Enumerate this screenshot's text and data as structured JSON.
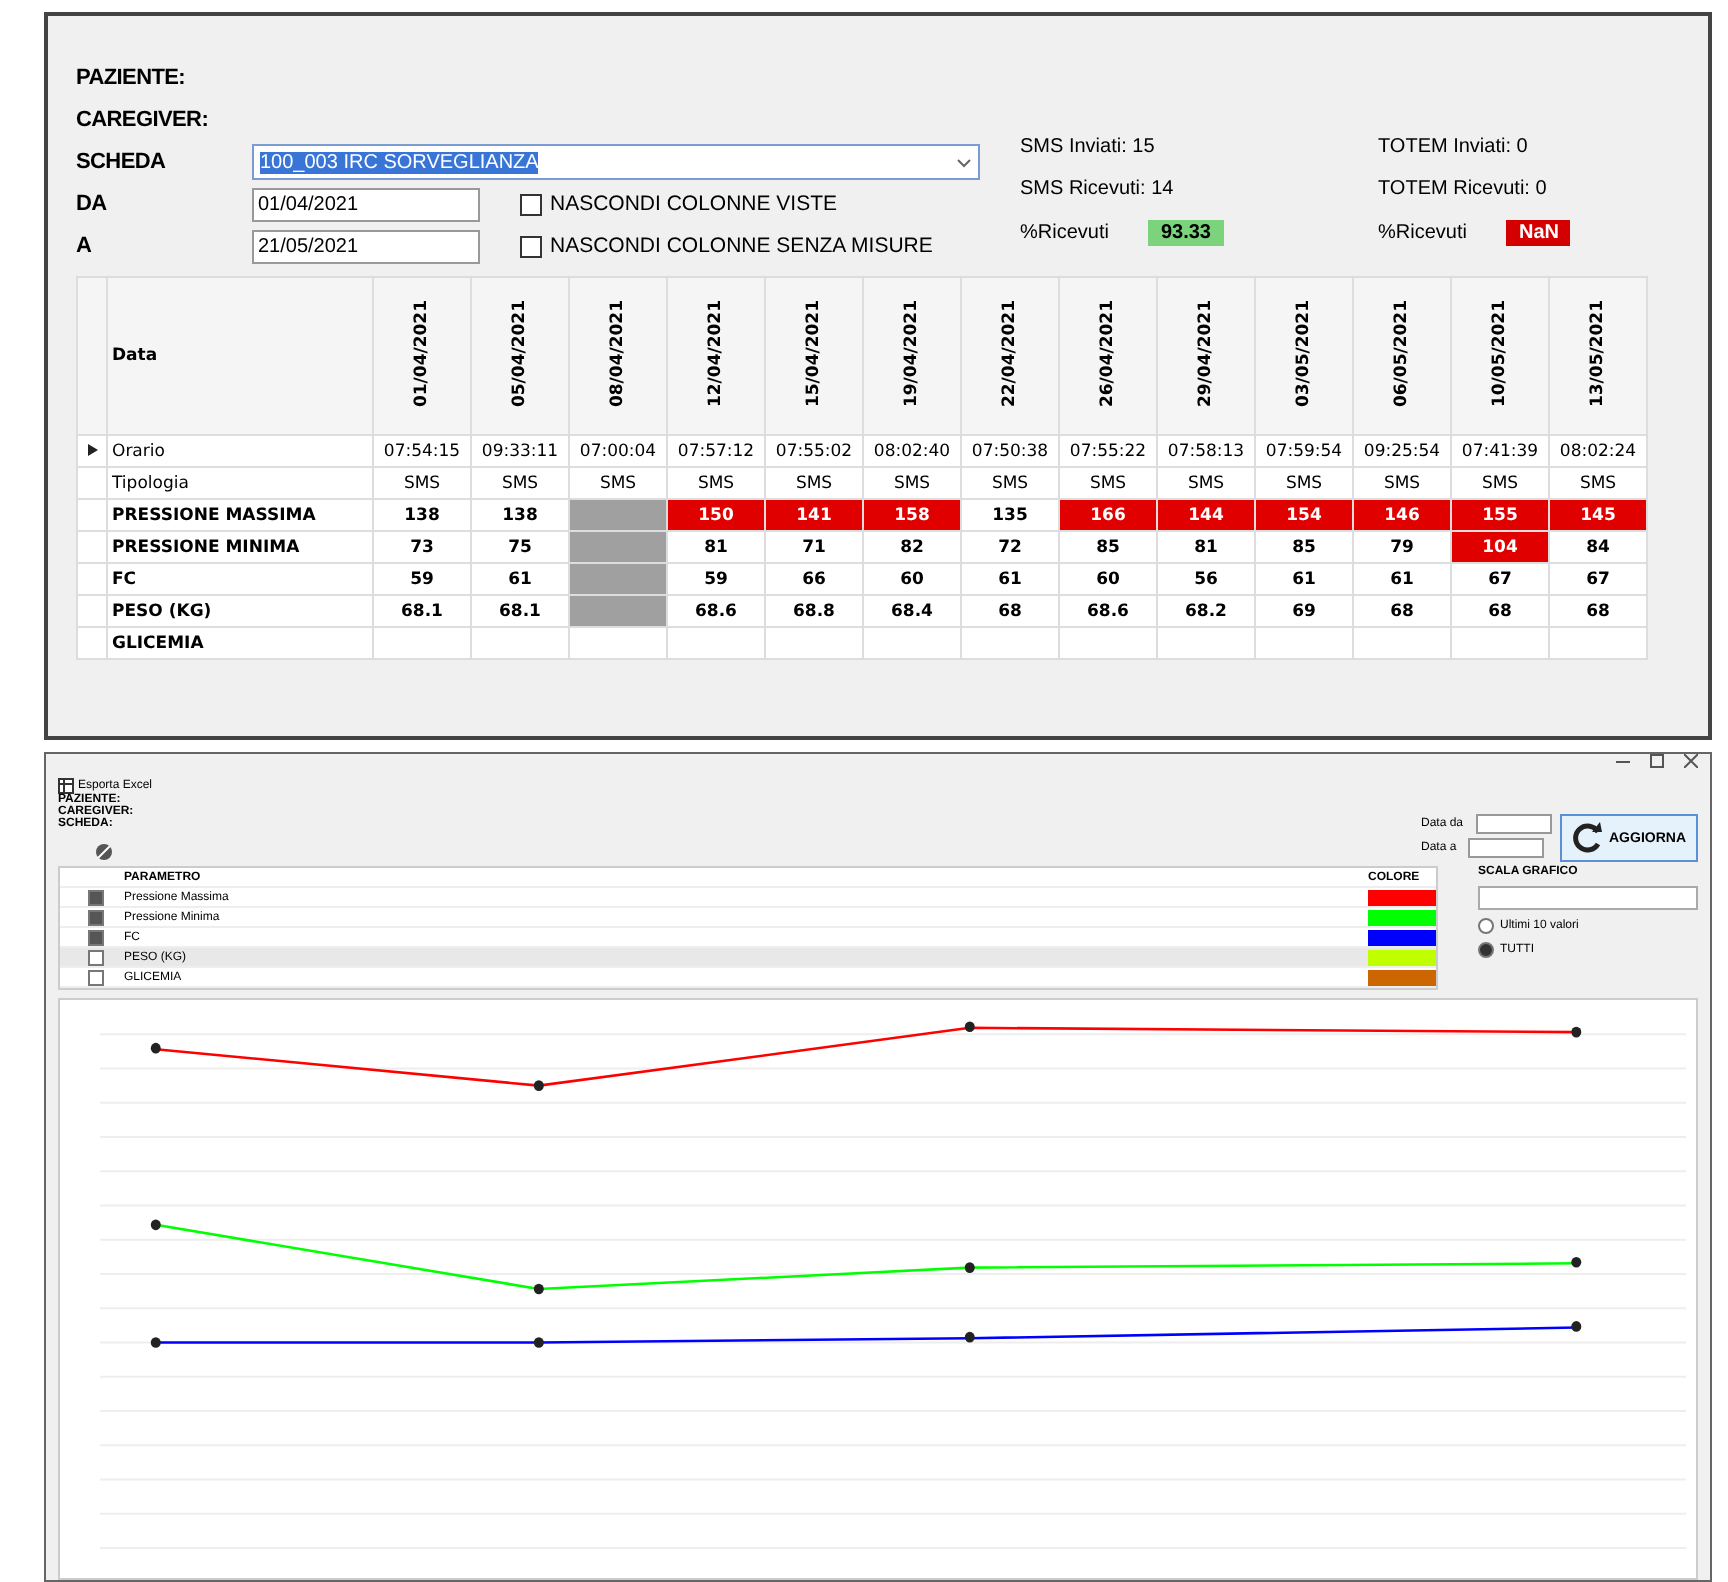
{
  "top": {
    "fields": [
      {
        "label": "PAZIENTE:"
      },
      {
        "label": "CAREGIVER:"
      }
    ],
    "scheda": {
      "label": "SCHEDA",
      "value": "100_003 IRC SORVEGLIANZA"
    },
    "da": {
      "label": "DA",
      "value": "01/04/2021"
    },
    "a": {
      "label": "A",
      "value": "21/05/2021"
    },
    "options": [
      {
        "label": "NASCONDI COLONNE VISTE",
        "checked": false
      },
      {
        "label": "NASCONDI COLONNE SENZA MISURE",
        "checked": false
      }
    ],
    "sms": {
      "sent": "SMS Inviati: 15",
      "received": "SMS Ricevuti: 14",
      "pct_label": "%Ricevuti",
      "pct": "93.33",
      "pct_ok": true
    },
    "totem": {
      "sent": "TOTEM Inviati: 0",
      "received": "TOTEM Ricevuti: 0",
      "pct_label": "%Ricevuti",
      "pct": "NaN",
      "pct_ok": false
    }
  },
  "table": {
    "corner": "Data",
    "columns": [
      "01/04/2021",
      "05/04/2021",
      "08/04/2021",
      "12/04/2021",
      "15/04/2021",
      "19/04/2021",
      "22/04/2021",
      "26/04/2021",
      "29/04/2021",
      "03/05/2021",
      "06/05/2021",
      "10/05/2021",
      "13/05/2021"
    ],
    "rows": [
      {
        "label": "Orario",
        "kind": "info",
        "selected": true,
        "cells": [
          {
            "text": "07:54:15",
            "alert": false,
            "greyed": false
          },
          {
            "text": "09:33:11",
            "alert": false,
            "greyed": false
          },
          {
            "text": "07:00:04",
            "alert": false,
            "greyed": false
          },
          {
            "text": "07:57:12",
            "alert": false,
            "greyed": false
          },
          {
            "text": "07:55:02",
            "alert": false,
            "greyed": false
          },
          {
            "text": "08:02:40",
            "alert": false,
            "greyed": false
          },
          {
            "text": "07:50:38",
            "alert": false,
            "greyed": false
          },
          {
            "text": "07:55:22",
            "alert": false,
            "greyed": false
          },
          {
            "text": "07:58:13",
            "alert": false,
            "greyed": false
          },
          {
            "text": "07:59:54",
            "alert": false,
            "greyed": false
          },
          {
            "text": "09:25:54",
            "alert": false,
            "greyed": false
          },
          {
            "text": "07:41:39",
            "alert": false,
            "greyed": false
          },
          {
            "text": "08:02:24",
            "alert": false,
            "greyed": false
          }
        ]
      },
      {
        "label": "Tipologia",
        "kind": "info",
        "selected": false,
        "cells": [
          {
            "text": "SMS",
            "alert": false,
            "greyed": false
          },
          {
            "text": "SMS",
            "alert": false,
            "greyed": false
          },
          {
            "text": "SMS",
            "alert": false,
            "greyed": false
          },
          {
            "text": "SMS",
            "alert": false,
            "greyed": false
          },
          {
            "text": "SMS",
            "alert": false,
            "greyed": false
          },
          {
            "text": "SMS",
            "alert": false,
            "greyed": false
          },
          {
            "text": "SMS",
            "alert": false,
            "greyed": false
          },
          {
            "text": "SMS",
            "alert": false,
            "greyed": false
          },
          {
            "text": "SMS",
            "alert": false,
            "greyed": false
          },
          {
            "text": "SMS",
            "alert": false,
            "greyed": false
          },
          {
            "text": "SMS",
            "alert": false,
            "greyed": false
          },
          {
            "text": "SMS",
            "alert": false,
            "greyed": false
          },
          {
            "text": "SMS",
            "alert": false,
            "greyed": false
          }
        ]
      },
      {
        "label": "PRESSIONE MASSIMA",
        "kind": "measure",
        "selected": false,
        "cells": [
          {
            "text": "138",
            "alert": false,
            "greyed": false
          },
          {
            "text": "138",
            "alert": false,
            "greyed": false
          },
          {
            "alert": false,
            "greyed": true
          },
          {
            "text": "150",
            "alert": true,
            "greyed": false
          },
          {
            "text": "141",
            "alert": true,
            "greyed": false
          },
          {
            "text": "158",
            "alert": true,
            "greyed": false
          },
          {
            "text": "135",
            "alert": false,
            "greyed": false
          },
          {
            "text": "166",
            "alert": true,
            "greyed": false
          },
          {
            "text": "144",
            "alert": true,
            "greyed": false
          },
          {
            "text": "154",
            "alert": true,
            "greyed": false
          },
          {
            "text": "146",
            "alert": true,
            "greyed": false
          },
          {
            "text": "155",
            "alert": true,
            "greyed": false
          },
          {
            "text": "145",
            "alert": true,
            "greyed": false
          }
        ]
      },
      {
        "label": "PRESSIONE MINIMA",
        "kind": "measure",
        "selected": false,
        "cells": [
          {
            "text": "73",
            "alert": false,
            "greyed": false
          },
          {
            "text": "75",
            "alert": false,
            "greyed": false
          },
          {
            "alert": false,
            "greyed": true
          },
          {
            "text": "81",
            "alert": false,
            "greyed": false
          },
          {
            "text": "71",
            "alert": false,
            "greyed": false
          },
          {
            "text": "82",
            "alert": false,
            "greyed": false
          },
          {
            "text": "72",
            "alert": false,
            "greyed": false
          },
          {
            "text": "85",
            "alert": false,
            "greyed": false
          },
          {
            "text": "81",
            "alert": false,
            "greyed": false
          },
          {
            "text": "85",
            "alert": false,
            "greyed": false
          },
          {
            "text": "79",
            "alert": false,
            "greyed": false
          },
          {
            "text": "104",
            "alert": true,
            "greyed": false
          },
          {
            "text": "84",
            "alert": false,
            "greyed": false
          }
        ]
      },
      {
        "label": "FC",
        "kind": "measure",
        "selected": false,
        "cells": [
          {
            "text": "59",
            "alert": false,
            "greyed": false
          },
          {
            "text": "61",
            "alert": false,
            "greyed": false
          },
          {
            "alert": false,
            "greyed": true
          },
          {
            "text": "59",
            "alert": false,
            "greyed": false
          },
          {
            "text": "66",
            "alert": false,
            "greyed": false
          },
          {
            "text": "60",
            "alert": false,
            "greyed": false
          },
          {
            "text": "61",
            "alert": false,
            "greyed": false
          },
          {
            "text": "60",
            "alert": false,
            "greyed": false
          },
          {
            "text": "56",
            "alert": false,
            "greyed": false
          },
          {
            "text": "61",
            "alert": false,
            "greyed": false
          },
          {
            "text": "61",
            "alert": false,
            "greyed": false
          },
          {
            "text": "67",
            "alert": false,
            "greyed": false
          },
          {
            "text": "67",
            "alert": false,
            "greyed": false
          }
        ]
      },
      {
        "label": "PESO (KG)",
        "kind": "measure",
        "selected": false,
        "cells": [
          {
            "text": "68.1",
            "alert": false,
            "greyed": false
          },
          {
            "text": "68.1",
            "alert": false,
            "greyed": false
          },
          {
            "alert": false,
            "greyed": true
          },
          {
            "text": "68.6",
            "alert": false,
            "greyed": false
          },
          {
            "text": "68.8",
            "alert": false,
            "greyed": false
          },
          {
            "text": "68.4",
            "alert": false,
            "greyed": false
          },
          {
            "text": "68",
            "alert": false,
            "greyed": false
          },
          {
            "text": "68.6",
            "alert": false,
            "greyed": false
          },
          {
            "text": "68.2",
            "alert": false,
            "greyed": false
          },
          {
            "text": "69",
            "alert": false,
            "greyed": false
          },
          {
            "text": "68",
            "alert": false,
            "greyed": false
          },
          {
            "text": "68",
            "alert": false,
            "greyed": false
          },
          {
            "text": "68",
            "alert": false,
            "greyed": false
          }
        ]
      },
      {
        "label": "GLICEMIA",
        "kind": "measure",
        "selected": false,
        "cells": [
          {
            "alert": false,
            "greyed": false
          },
          {
            "alert": false,
            "greyed": false
          },
          {
            "alert": false,
            "greyed": false
          },
          {
            "alert": false,
            "greyed": false
          },
          {
            "alert": false,
            "greyed": false
          },
          {
            "alert": false,
            "greyed": false
          },
          {
            "alert": false,
            "greyed": false
          },
          {
            "alert": false,
            "greyed": false
          },
          {
            "alert": false,
            "greyed": false
          },
          {
            "alert": false,
            "greyed": false
          },
          {
            "alert": false,
            "greyed": false
          },
          {
            "alert": false,
            "greyed": false
          },
          {
            "alert": false,
            "greyed": false
          }
        ]
      }
    ]
  },
  "lower": {
    "export": "Esporta Excel",
    "fields": [
      "PAZIENTE:",
      "CAREGIVER:",
      "SCHEDA:"
    ],
    "date_from": "Data da",
    "date_to": "Data a",
    "refresh": "AGGIORNA",
    "param_header": "PARAMETRO",
    "color_header": "COLORE",
    "params": [
      {
        "name": "Pressione Massima",
        "checked": true,
        "selected": false,
        "color": "#ff0000"
      },
      {
        "name": "Pressione Minima",
        "checked": true,
        "selected": false,
        "color": "#00ff00"
      },
      {
        "name": "FC",
        "checked": true,
        "selected": false,
        "color": "#0000ff"
      },
      {
        "name": "PESO (KG)",
        "checked": false,
        "selected": true,
        "color": "#bfff00"
      },
      {
        "name": "GLICEMIA",
        "checked": false,
        "selected": false,
        "color": "#cc6600"
      }
    ],
    "scale_label": "SCALA GRAFICO",
    "radios": [
      {
        "label": "Ultimi 10 valori",
        "selected": false
      },
      {
        "label": "TUTTI",
        "selected": true
      }
    ]
  }
}
